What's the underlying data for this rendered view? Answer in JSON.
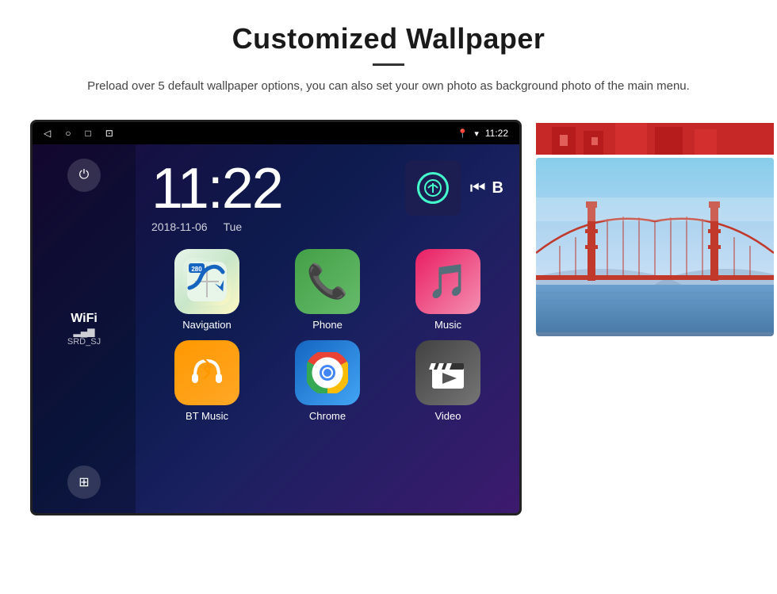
{
  "header": {
    "title": "Customized Wallpaper",
    "description": "Preload over 5 default wallpaper options, you can also set your own photo as background photo of the main menu."
  },
  "device": {
    "status_bar": {
      "nav_back": "◁",
      "nav_home": "○",
      "nav_square": "□",
      "nav_screenshot": "⊡",
      "location_icon": "📍",
      "wifi_icon": "▼",
      "time": "11:22"
    },
    "clock": {
      "time": "11:22",
      "date": "2018-11-06",
      "day": "Tue"
    },
    "wifi": {
      "label": "WiFi",
      "bars": "▂▄▆",
      "network": "SRD_SJ"
    },
    "apps": [
      {
        "label": "Navigation",
        "type": "navigation"
      },
      {
        "label": "Phone",
        "type": "phone"
      },
      {
        "label": "Music",
        "type": "music"
      },
      {
        "label": "BT Music",
        "type": "btmusic"
      },
      {
        "label": "Chrome",
        "type": "chrome"
      },
      {
        "label": "Video",
        "type": "video"
      }
    ],
    "nav_badge": "280"
  }
}
